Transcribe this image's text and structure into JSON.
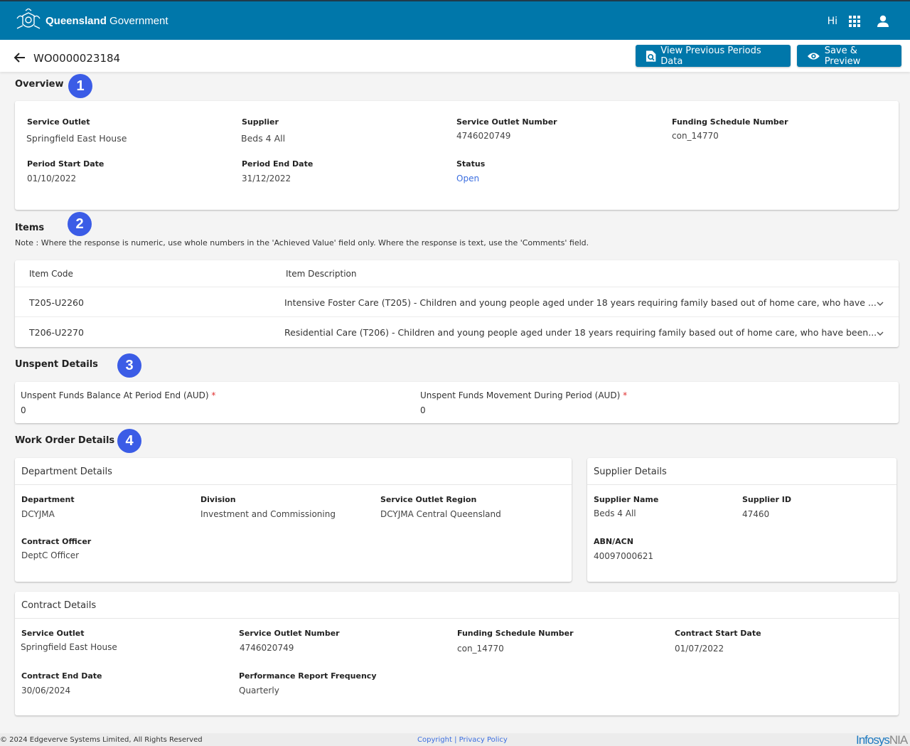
{
  "header": {
    "brand_bold": "Queensland",
    "brand_regular": "Government",
    "greeting": "Hi",
    "icons": {
      "crest": "qld-crest-logo",
      "apps": "apps-grid-icon",
      "user": "user-icon"
    }
  },
  "subbar": {
    "work_order_id": "WO0000023184",
    "back_icon": "arrow-left-icon",
    "buttons": {
      "view_previous": "View Previous Periods Data",
      "save_preview": "Save & Preview"
    }
  },
  "colors": {
    "primary": "#0077aa",
    "badge": "#3b5ce6",
    "link": "#3b6ee0",
    "required": "#e03030"
  },
  "overview": {
    "title": "Overview",
    "badge": "1",
    "fields": {
      "service_outlet": {
        "label": "Service Outlet",
        "value": "Springfield East House"
      },
      "supplier": {
        "label": "Supplier",
        "value": "Beds 4 All"
      },
      "service_outlet_number": {
        "label": "Service Outlet Number",
        "value": "4746020749"
      },
      "funding_schedule_number": {
        "label": "Funding Schedule Number",
        "value": "con_14770"
      },
      "period_start_date": {
        "label": "Period Start Date",
        "value": "01/10/2022"
      },
      "period_end_date": {
        "label": "Period End Date",
        "value": "31/12/2022"
      },
      "status": {
        "label": "Status",
        "value": "Open"
      }
    }
  },
  "items": {
    "title": "Items",
    "badge": "2",
    "note": "Note : Where the response is numeric, use whole numbers in the 'Achieved Value' field only. Where the response is text, use the 'Comments' field.",
    "columns": [
      "Item Code",
      "Item Description"
    ],
    "rows": [
      {
        "code": "T205-U2260",
        "description": "Intensive Foster Care (T205) - Children and young people aged under 18 years requiring family based out of home care, who have ..."
      },
      {
        "code": "T206-U2270",
        "description": "Residential Care (T206) - Children and young people aged under 18 years requiring family based out of home care, who have been..."
      }
    ]
  },
  "unspent": {
    "title": "Unspent Details",
    "badge": "3",
    "balance": {
      "label": "Unspent Funds Balance At Period End (AUD)",
      "required": "*",
      "value": "0"
    },
    "movement": {
      "label": "Unspent Funds Movement During Period (AUD)",
      "required": "*",
      "value": "0"
    }
  },
  "work_order": {
    "title": "Work Order Details",
    "badge": "4",
    "department": {
      "title": "Department Details",
      "department": {
        "label": "Department",
        "value": "DCYJMA"
      },
      "division": {
        "label": "Division",
        "value": "Investment and Commissioning"
      },
      "region": {
        "label": "Service Outlet Region",
        "value": "DCYJMA Central Queensland"
      },
      "officer": {
        "label": "Contract Officer",
        "value": "DeptC Officer"
      }
    },
    "supplier": {
      "title": "Supplier Details",
      "name": {
        "label": "Supplier Name",
        "value": "Beds 4 All"
      },
      "id": {
        "label": "Supplier ID",
        "value": "47460"
      },
      "abn": {
        "label": "ABN/ACN",
        "value": "40097000621"
      }
    },
    "contract": {
      "title": "Contract Details",
      "service_outlet": {
        "label": "Service Outlet",
        "value": "Springfield East House"
      },
      "service_outlet_number": {
        "label": "Service Outlet Number",
        "value": "4746020749"
      },
      "funding_schedule_number": {
        "label": "Funding Schedule Number",
        "value": "con_14770"
      },
      "start_date": {
        "label": "Contract Start Date",
        "value": "01/07/2022"
      },
      "end_date": {
        "label": "Contract End Date",
        "value": "30/06/2024"
      },
      "frequency": {
        "label": "Performance Report Frequency",
        "value": "Quarterly"
      }
    }
  },
  "footer": {
    "copyright": "© 2024  Edgeverve Systems Limited, All Rights Reserved",
    "copyright_link": "Copyright",
    "separator": "|",
    "privacy_link": "Privacy Policy",
    "logo_main": "Infosys",
    "logo_suffix": "NIA"
  }
}
